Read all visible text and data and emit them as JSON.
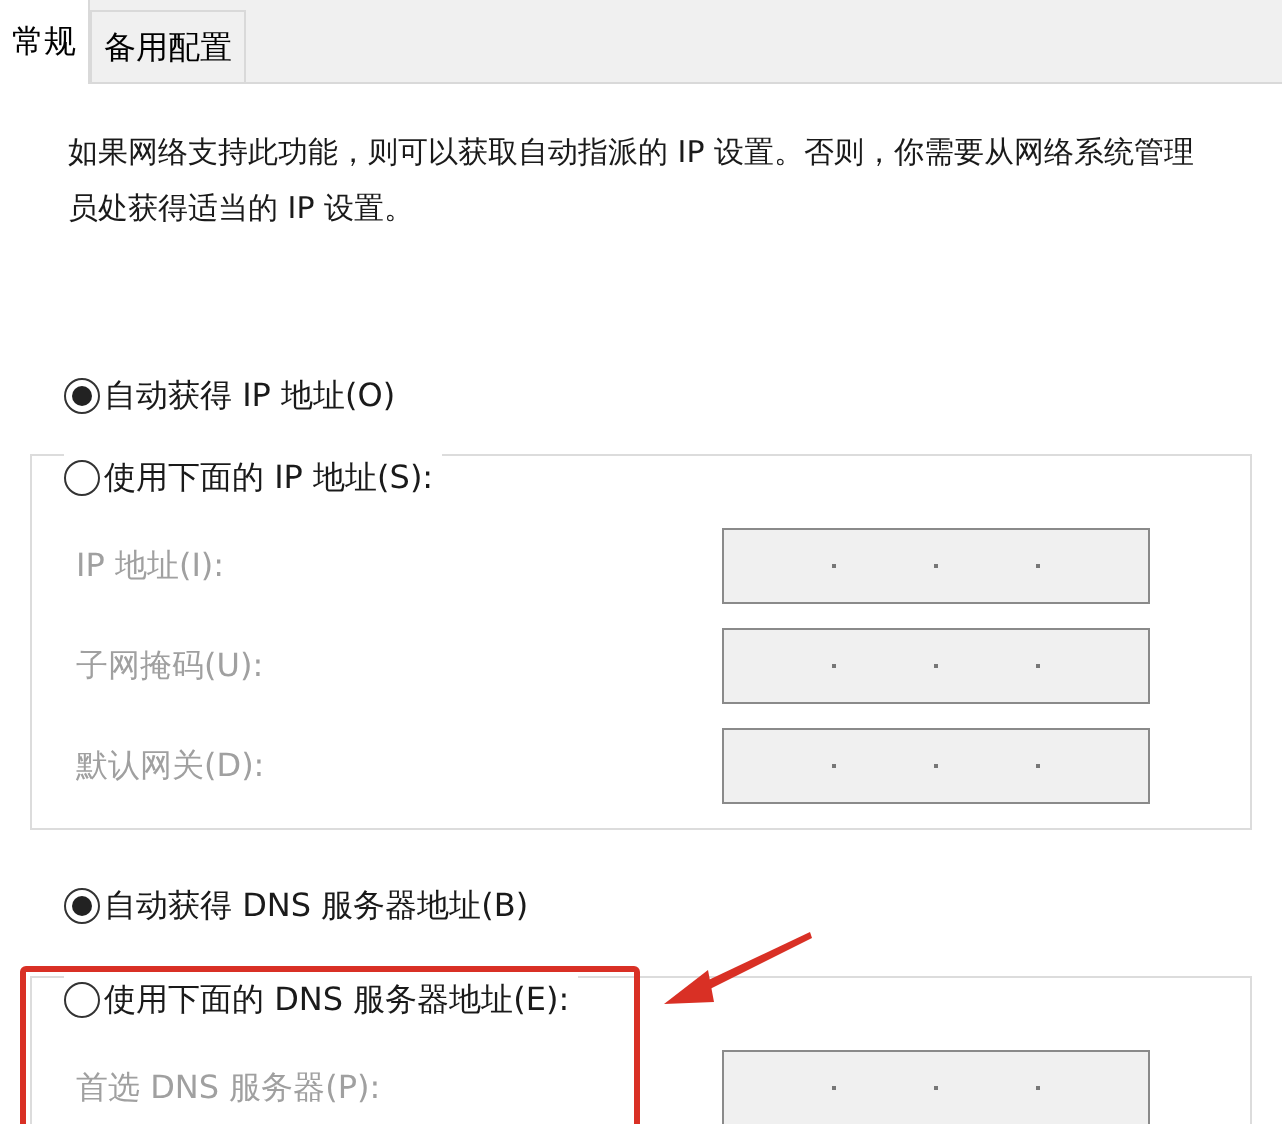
{
  "tabs": [
    {
      "label": "常规",
      "selected": true
    },
    {
      "label": "备用配置",
      "selected": false
    }
  ],
  "description": "如果网络支持此功能，则可以获取自动指派的 IP 设置。否则，你需要从网络系统管理员处获得适当的 IP 设置。",
  "ip": {
    "auto_option": {
      "label": "自动获得 IP 地址(O)",
      "selected": true
    },
    "manual_option": {
      "label": "使用下面的 IP 地址(S):",
      "selected": false
    },
    "fields": [
      {
        "label": "IP 地址(I):",
        "disabled": true
      },
      {
        "label": "子网掩码(U):",
        "disabled": true
      },
      {
        "label": "默认网关(D):",
        "disabled": true
      }
    ]
  },
  "dns": {
    "auto_option": {
      "label": "自动获得 DNS 服务器地址(B)",
      "selected": true
    },
    "manual_option": {
      "label": "使用下面的 DNS 服务器地址(E):",
      "selected": false
    },
    "fields": [
      {
        "label": "首选 DNS 服务器(P):",
        "disabled": true
      }
    ]
  }
}
